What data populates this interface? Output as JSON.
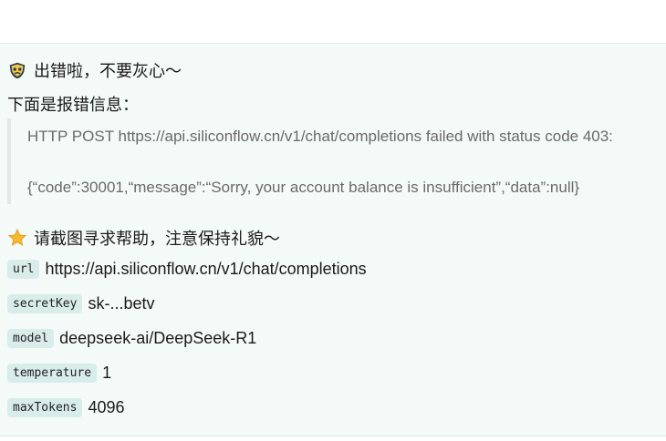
{
  "error": {
    "title": "出错啦，不要灰心～",
    "subtitle": "下面是报错信息：",
    "message_line1": "HTTP POST https://api.siliconflow.cn/v1/chat/completions failed with status code 403:",
    "message_line2": "{“code”:30001,“message”:“Sorry, your account balance is insufficient”,“data”:null}"
  },
  "help": {
    "text": "请截图寻求帮助，注意保持礼貌～"
  },
  "params": [
    {
      "key": "url",
      "value": "https://api.siliconflow.cn/v1/chat/completions"
    },
    {
      "key": "secretKey",
      "value": "sk-...betv"
    },
    {
      "key": "model",
      "value": "deepseek-ai/DeepSeek-R1"
    },
    {
      "key": "temperature",
      "value": "1"
    },
    {
      "key": "maxTokens",
      "value": "4096"
    }
  ],
  "icons": {
    "title_icon": "sad-mask-icon",
    "help_icon": "star-icon"
  },
  "colors": {
    "panel_bg": "#f4faf8",
    "key_bg": "#d8ecea",
    "quote_text": "#6a6a6a",
    "star": "#f5b82e"
  }
}
